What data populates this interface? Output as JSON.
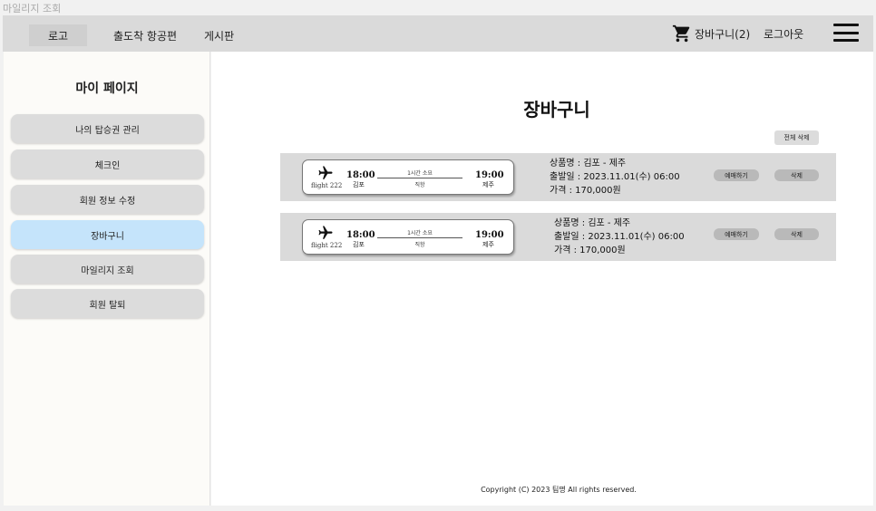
{
  "page": {
    "tab_label": "마일리지 조회"
  },
  "header": {
    "logo_label": "로고",
    "nav": [
      "출도착 항공편",
      "게시판"
    ],
    "cart_label": "장바구니(2)",
    "logout_label": "로그아웃",
    "icons": {
      "cart": "shopping-cart-icon",
      "menu": "hamburger-menu-icon"
    }
  },
  "sidebar": {
    "title": "마이 페이지",
    "items": [
      {
        "label": "나의 탑승권 관리"
      },
      {
        "label": "체크인"
      },
      {
        "label": "회원 정보 수정"
      },
      {
        "label": "장바구니",
        "active": true
      },
      {
        "label": "마일리지 조회"
      },
      {
        "label": "회원 탈퇴"
      }
    ]
  },
  "main": {
    "title": "장바구니",
    "delete_all_label": "전체 삭제",
    "items": [
      {
        "flight_no": "flight 222",
        "dep_time": "18:00",
        "dep_city": "김포",
        "arr_time": "19:00",
        "arr_city": "제주",
        "duration": "1시간 소요",
        "direct": "직항",
        "product": "상품명 : 김포 - 제주",
        "departure_date": "출발일 : 2023.11.01(수) 06:00",
        "price": "가격 : 170,000원",
        "reserve_label": "예매하기",
        "delete_label": "삭제"
      },
      {
        "flight_no": "flight 222",
        "dep_time": "18:00",
        "dep_city": "김포",
        "arr_time": "19:00",
        "arr_city": "제주",
        "duration": "1시간 소요",
        "direct": "직항",
        "product": "상품명 : 김포 - 제주",
        "departure_date": "출발일 : 2023.11.01(수) 06:00",
        "price": "가격 : 170,000원",
        "reserve_label": "예매하기",
        "delete_label": "삭제"
      }
    ]
  },
  "footer": {
    "copyright": "Copyright (C) 2023 팀명 All rights reserved."
  },
  "colors": {
    "active_item": "#c5e4fb",
    "topbar": "#dadada",
    "item_bg": "#dadada"
  }
}
